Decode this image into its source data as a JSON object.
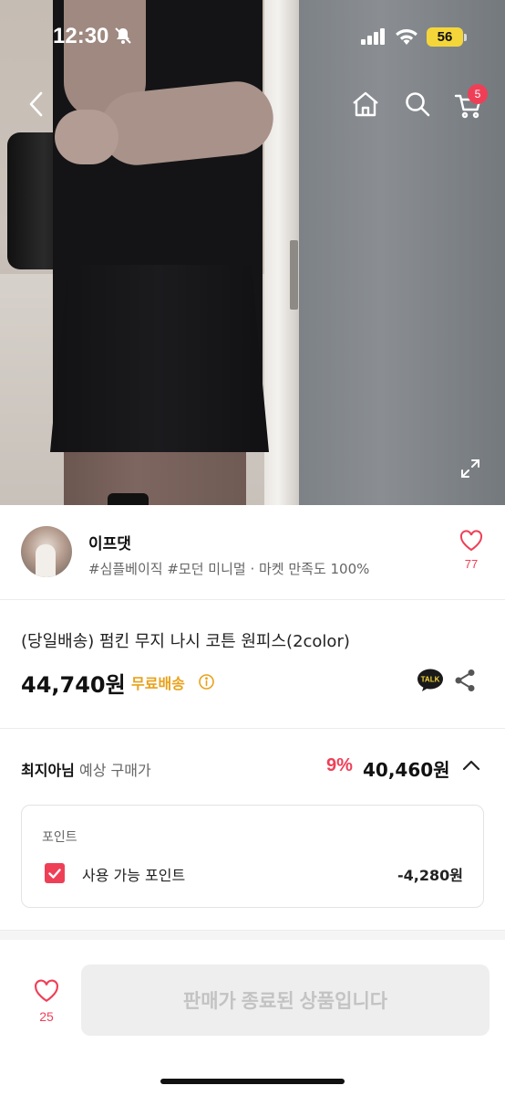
{
  "status_bar": {
    "time": "12:30",
    "battery": "56"
  },
  "nav": {
    "cart_count": "5"
  },
  "seller": {
    "name": "이프댓",
    "tags": "#심플베이직 #모던 미니멀 · 마켓 만족도 100%",
    "like_count": "77"
  },
  "product": {
    "title": "(당일배송) 펌킨 무지 나시 코튼 원피스(2color)",
    "price": "44,740원",
    "shipping": "무료배송",
    "talk_label": "TALK"
  },
  "expected": {
    "user": "최지아님",
    "label": "예상 구매가",
    "discount": "9%",
    "final_price": "40,460원"
  },
  "points": {
    "title": "포인트",
    "available_label": "사용 가능 포인트",
    "amount": "-4,280원",
    "checked": true
  },
  "bottom": {
    "like_count": "25",
    "cta_label": "판매가 종료된 상품입니다"
  },
  "colors": {
    "accent": "#ef3f57",
    "shipping": "#e9a11b",
    "disabled_bg": "#eeeeee",
    "disabled_text": "#c3c3c3"
  }
}
